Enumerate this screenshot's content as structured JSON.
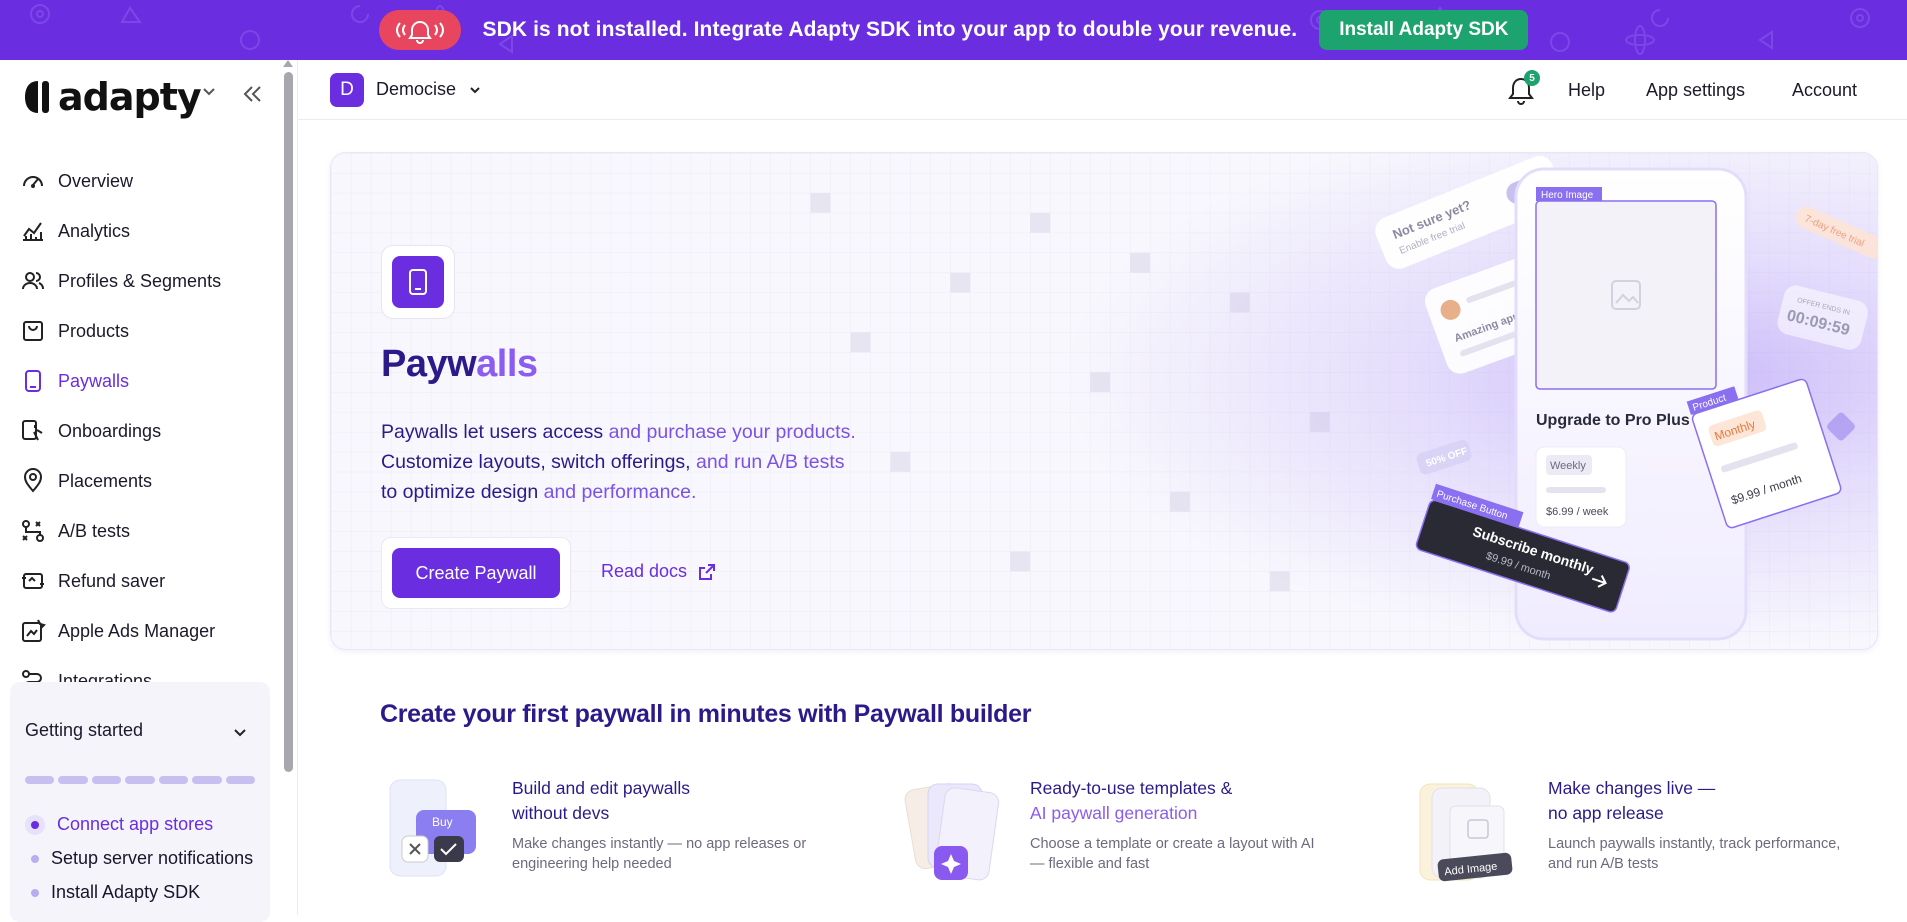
{
  "banner": {
    "message": "SDK is not installed. Integrate Adapty SDK into your app to double your revenue.",
    "button_label": "Install Adapty SDK"
  },
  "sidebar": {
    "logo_text": "adapty",
    "items": [
      {
        "label": "Overview",
        "icon": "gauge-icon"
      },
      {
        "label": "Analytics",
        "icon": "chart-icon"
      },
      {
        "label": "Profiles & Segments",
        "icon": "users-icon"
      },
      {
        "label": "Products",
        "icon": "bag-icon"
      },
      {
        "label": "Paywalls",
        "icon": "phone-icon",
        "active": true
      },
      {
        "label": "Onboardings",
        "icon": "onboarding-icon"
      },
      {
        "label": "Placements",
        "icon": "pin-icon"
      },
      {
        "label": "A/B tests",
        "icon": "ab-icon"
      },
      {
        "label": "Refund saver",
        "icon": "refund-icon"
      },
      {
        "label": "Apple Ads Manager",
        "icon": "ads-icon"
      },
      {
        "label": "Integrations",
        "icon": "integrations-icon"
      }
    ],
    "getting_started": {
      "title": "Getting started",
      "tasks": [
        "Connect app stores",
        "Setup server notifications",
        "Install Adapty SDK"
      ]
    }
  },
  "header": {
    "app_initial": "D",
    "app_name": "Democise",
    "notification_count": "5",
    "links": [
      "Help",
      "App settings",
      "Account"
    ]
  },
  "hero": {
    "title_main": "Payw",
    "title_fade": "alls",
    "desc_line1_a": "Paywalls let users access ",
    "desc_line1_b": "and purchase your products.",
    "desc_line2_a": "Customize layouts, switch offerings, ",
    "desc_line2_b": "and run A/B tests",
    "desc_line3_a": "to optimize design ",
    "desc_line3_b": "and performance.",
    "create_button": "Create Paywall",
    "read_docs": "Read docs",
    "illustration": {
      "not_sure": "Not sure yet?",
      "enable_trial": "Enable free trial",
      "amazing_app": "Amazing app!",
      "hero_image_tag": "Hero Image",
      "upgrade_title": "Upgrade to Pro Plus",
      "weekly_label": "Weekly",
      "weekly_price": "$6.99 / week",
      "product_tag": "Product",
      "monthly_label": "Monthly",
      "monthly_price": "$9.99 / month",
      "purchase_tag": "Purchase Button",
      "subscribe_label": "Subscribe monthly",
      "subscribe_price": "$9.99 / month",
      "discount_tag": "50% OFF",
      "trial_tag": "7-day free trial",
      "offer_label": "OFFER ENDS IN",
      "timer": "00:09:59"
    }
  },
  "builder": {
    "title": "Create your first paywall in minutes with Paywall builder",
    "features": [
      {
        "title_a": "Build and edit paywalls",
        "title_b": "without devs",
        "title_b_light": false,
        "desc": "Make changes instantly — no app releases or engineering help needed",
        "tag": "Buy"
      },
      {
        "title_a": "Ready-to-use templates &",
        "title_b": "AI paywall generation",
        "title_b_light": true,
        "desc": "Choose a template or create a layout with AI — flexible and fast",
        "tag": ""
      },
      {
        "title_a": "Make changes live —",
        "title_b": "no app release",
        "title_b_light": false,
        "desc": "Launch paywalls instantly, track performance, and run A/B tests",
        "tag": "Add Image"
      }
    ]
  },
  "colors": {
    "brand": "#6a2ee0",
    "banner_alert": "#e8465f",
    "install_green": "#1da36e",
    "heading": "#2c1a8a"
  }
}
